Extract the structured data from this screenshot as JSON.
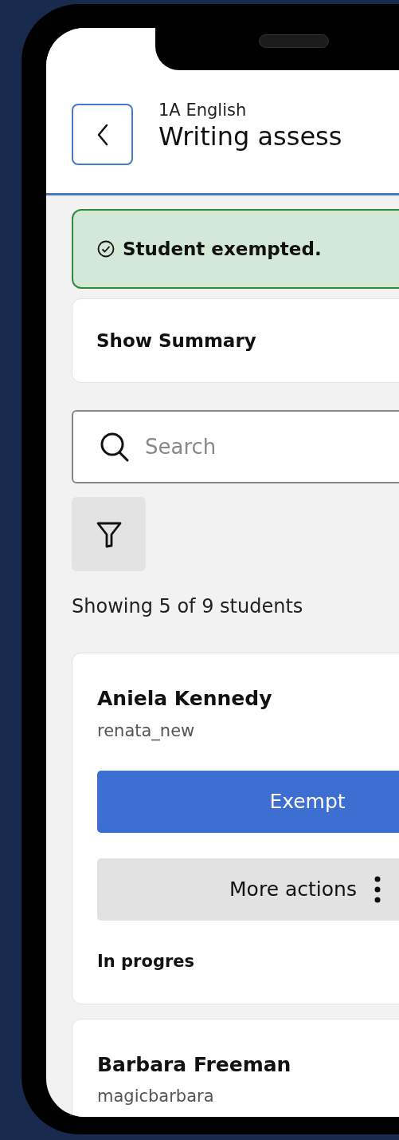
{
  "header": {
    "course": "1A English",
    "title": "Writing assess"
  },
  "alert": {
    "message": "Student exempted."
  },
  "summary": {
    "label": "Show Summary"
  },
  "search": {
    "placeholder": "Search"
  },
  "result_count": "Showing 5 of 9 students",
  "students": [
    {
      "name": "Aniela Kennedy",
      "username": "renata_new",
      "primary_action": "Exempt",
      "secondary_action": "More actions",
      "status": "In progres"
    },
    {
      "name": "Barbara Freeman",
      "username": "magicbarbara"
    }
  ]
}
